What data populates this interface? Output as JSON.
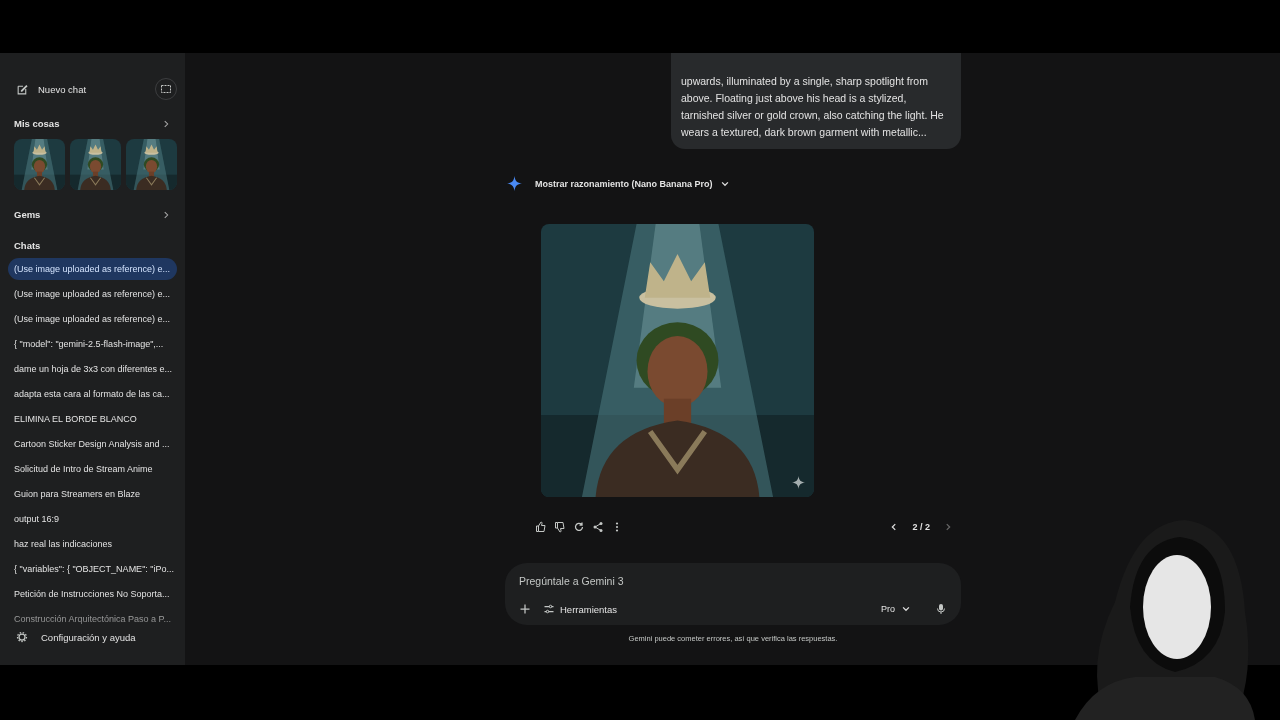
{
  "sidebar": {
    "new_chat": "Nuevo chat",
    "my_stuff": {
      "title": "Mis cosas"
    },
    "gems": "Gems",
    "chats_title": "Chats",
    "chats": [
      {
        "title": "(Use image uploaded as reference) e...",
        "selected": true
      },
      {
        "title": "(Use image uploaded as reference) e...",
        "selected": false
      },
      {
        "title": "(Use image uploaded as reference) e...",
        "selected": false
      },
      {
        "title": "{   \"model\": \"gemini-2.5-flash-image\",...",
        "selected": false
      },
      {
        "title": "dame un hoja de 3x3 con diferentes e...",
        "selected": false
      },
      {
        "title": "adapta esta cara al formato de las ca...",
        "selected": false
      },
      {
        "title": "ELIMINA EL BORDE BLANCO",
        "selected": false
      },
      {
        "title": "Cartoon Sticker Design Analysis and ...",
        "selected": false
      },
      {
        "title": "Solicitud de Intro de Stream Anime",
        "selected": false
      },
      {
        "title": "Guion para Streamers en Blaze",
        "selected": false
      },
      {
        "title": "output 16:9",
        "selected": false
      },
      {
        "title": "haz real las indicaciones",
        "selected": false
      },
      {
        "title": "{ \"variables\": { \"OBJECT_NAME\": \"iPo...",
        "selected": false
      },
      {
        "title": "Petición de Instrucciones No Soporta...",
        "selected": false
      },
      {
        "title": "Construcción Arquitectónica Paso a P...",
        "selected": false
      }
    ],
    "settings": "Configuración y ayuda"
  },
  "conversation": {
    "user_message": "upwards, illuminated by a single, sharp spotlight from above. Floating just above his head is a stylized, tarnished silver or gold crown, also catching the light. He wears a textured, dark brown garment with metallic...",
    "response": {
      "reasoning_label": "Mostrar razonamiento (Nano Banana Pro)",
      "pager": "2 / 2"
    }
  },
  "composer": {
    "placeholder": "Pregúntale a Gemini 3",
    "tools": "Herramientas",
    "model": "Pro"
  },
  "disclaimer": "Gemini puede cometer errores, así que verifica las respuestas."
}
